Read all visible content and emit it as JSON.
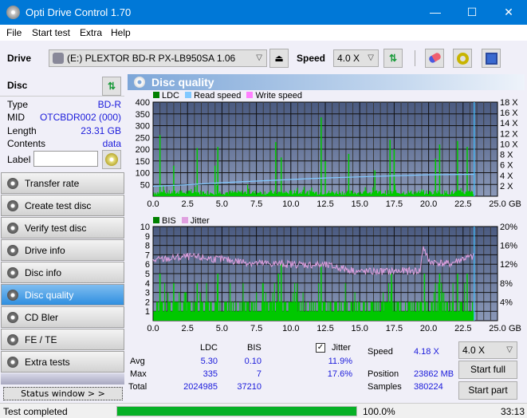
{
  "window": {
    "title": "Opti Drive Control 1.70",
    "minimize": "—",
    "maximize": "☐",
    "close": "✕"
  },
  "menu": [
    "File",
    "Start test",
    "Extra",
    "Help"
  ],
  "toolbar": {
    "drive_label": "Drive",
    "drive_value": "(E:)  PLEXTOR BD-R  PX-LB950SA 1.06",
    "speed_label": "Speed",
    "speed_value": "4.0 X"
  },
  "disc": {
    "header": "Disc",
    "rows": [
      {
        "key": "Type",
        "value": "BD-R"
      },
      {
        "key": "MID",
        "value": "OTCBDR002 (000)"
      },
      {
        "key": "Length",
        "value": "23.31 GB"
      },
      {
        "key": "Contents",
        "value": "data"
      }
    ],
    "label_key": "Label",
    "label_value": ""
  },
  "nav": [
    {
      "label": "Transfer rate",
      "active": false
    },
    {
      "label": "Create test disc",
      "active": false
    },
    {
      "label": "Verify test disc",
      "active": false
    },
    {
      "label": "Drive info",
      "active": false
    },
    {
      "label": "Disc info",
      "active": false
    },
    {
      "label": "Disc quality",
      "active": true
    },
    {
      "label": "CD Bler",
      "active": false
    },
    {
      "label": "FE / TE",
      "active": false
    },
    {
      "label": "Extra tests",
      "active": false
    }
  ],
  "status_window_btn": "Status window > >",
  "panel_title": "Disc quality",
  "chart_data": [
    {
      "type": "bar",
      "title": "LDC",
      "legend": [
        "LDC",
        "Read speed",
        "Write speed"
      ],
      "colors": {
        "LDC": "#00c800",
        "Read speed": "#80c8ff",
        "Write speed": "#ff80ff"
      },
      "xlabel": "GB",
      "xlim": [
        0,
        25
      ],
      "x_ticks": [
        "0.0",
        "2.5",
        "5.0",
        "7.5",
        "10.0",
        "12.5",
        "15.0",
        "17.5",
        "20.0",
        "22.5",
        "25.0"
      ],
      "ylim": [
        0,
        400
      ],
      "y_ticks": [
        "50",
        "100",
        "150",
        "200",
        "250",
        "300",
        "350",
        "400"
      ],
      "y2lim": [
        0,
        18
      ],
      "y2_ticks": [
        "2 X",
        "4 X",
        "6 X",
        "8 X",
        "10 X",
        "12 X",
        "14 X",
        "16 X",
        "18 X"
      ],
      "ldc_peaks": [
        [
          0.5,
          260
        ],
        [
          1.5,
          130
        ],
        [
          3.2,
          205
        ],
        [
          4.5,
          130
        ],
        [
          4.7,
          210
        ],
        [
          8.9,
          230
        ],
        [
          9.3,
          165
        ],
        [
          12.2,
          335
        ],
        [
          12.5,
          150
        ],
        [
          14.2,
          180
        ],
        [
          16.1,
          110
        ],
        [
          17.2,
          240
        ],
        [
          17.5,
          200
        ],
        [
          20.5,
          160
        ],
        [
          20.8,
          220
        ],
        [
          22.1,
          235
        ],
        [
          22.8,
          210
        ]
      ],
      "ldc_base": 20,
      "read_speed": [
        [
          0,
          1.9
        ],
        [
          2.5,
          2.2
        ],
        [
          5,
          2.6
        ],
        [
          7.5,
          2.9
        ],
        [
          10,
          3.2
        ],
        [
          12.5,
          3.5
        ],
        [
          15,
          3.7
        ],
        [
          17.5,
          3.9
        ],
        [
          20,
          4.1
        ],
        [
          23.3,
          4.2
        ]
      ],
      "end_marker_gb": 23.31
    },
    {
      "type": "bar",
      "title": "BIS",
      "legend": [
        "BIS",
        "Jitter"
      ],
      "colors": {
        "BIS": "#00c800",
        "Jitter": "#e0a0e0"
      },
      "xlabel": "GB",
      "xlim": [
        0,
        25
      ],
      "x_ticks": [
        "0.0",
        "2.5",
        "5.0",
        "7.5",
        "10.0",
        "12.5",
        "15.0",
        "17.5",
        "20.0",
        "22.5",
        "25.0"
      ],
      "ylim": [
        0,
        10
      ],
      "y_ticks": [
        "1",
        "2",
        "3",
        "4",
        "5",
        "6",
        "7",
        "8",
        "9",
        "10"
      ],
      "y2lim": [
        0,
        20
      ],
      "y2_ticks": [
        "4%",
        "8%",
        "12%",
        "16%",
        "20%"
      ],
      "bis_peaks": [
        [
          0.5,
          5
        ],
        [
          1.5,
          4
        ],
        [
          3.2,
          4
        ],
        [
          4.7,
          5
        ],
        [
          9.1,
          5
        ],
        [
          9.3,
          6
        ],
        [
          12.2,
          6
        ],
        [
          17.3,
          5
        ],
        [
          19.7,
          5
        ],
        [
          20.8,
          5
        ],
        [
          22.1,
          5
        ],
        [
          22.8,
          5
        ]
      ],
      "bis_base": 2,
      "jitter": [
        [
          0,
          12.8
        ],
        [
          2.5,
          13.6
        ],
        [
          5,
          13.0
        ],
        [
          7.5,
          12.2
        ],
        [
          10,
          12.0
        ],
        [
          12.5,
          11.8
        ],
        [
          15,
          10.4
        ],
        [
          17.5,
          10.5
        ],
        [
          19.4,
          10.6
        ],
        [
          19.6,
          16
        ],
        [
          20,
          12.6
        ],
        [
          21.5,
          12.0
        ],
        [
          22.5,
          13.2
        ],
        [
          23.3,
          13.6
        ]
      ],
      "end_marker_gb": 23.31
    }
  ],
  "stats": {
    "col_ldc": "LDC",
    "col_bis": "BIS",
    "jitter_label": "Jitter",
    "jitter_checked": true,
    "rows": [
      {
        "label": "Avg",
        "ldc": "5.30",
        "bis": "0.10",
        "jitter": "11.9%"
      },
      {
        "label": "Max",
        "ldc": "335",
        "bis": "7",
        "jitter": "17.6%"
      },
      {
        "label": "Total",
        "ldc": "2024985",
        "bis": "37210",
        "jitter": ""
      }
    ],
    "speed_label": "Speed",
    "speed_value": "4.18 X",
    "position_label": "Position",
    "position_value": "23862 MB",
    "samples_label": "Samples",
    "samples_value": "380224",
    "speed_select": "4.0 X",
    "start_full": "Start full",
    "start_part": "Start part"
  },
  "status": {
    "text": "Test completed",
    "progress": 100.0,
    "progress_text": "100.0%",
    "time": "33:13"
  }
}
